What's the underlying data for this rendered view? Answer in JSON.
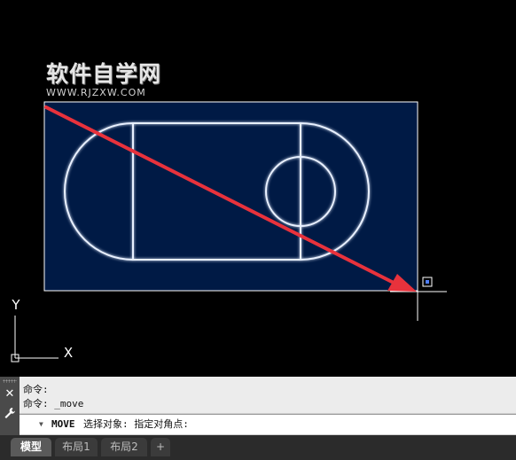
{
  "watermark": {
    "title": "软件自学网",
    "url": "WWW.RJZXW.COM"
  },
  "ucs": {
    "x_label": "X",
    "y_label": "Y"
  },
  "command_window": {
    "history": [
      "命令:",
      "命令: _move"
    ],
    "prompt_command": "MOVE",
    "prompt_text": "选择对象: 指定对角点:",
    "close_icon": "close-icon",
    "settings_icon": "wrench-icon"
  },
  "tabs": [
    {
      "label": "模型",
      "active": true
    },
    {
      "label": "布局1",
      "active": false
    },
    {
      "label": "布局2",
      "active": false
    },
    {
      "label": "+",
      "active": false
    }
  ],
  "colors": {
    "background": "#000000",
    "selection_fill": "#001a45",
    "geometry": "#e8f0ff",
    "annotation_arrow": "#e8323c"
  }
}
